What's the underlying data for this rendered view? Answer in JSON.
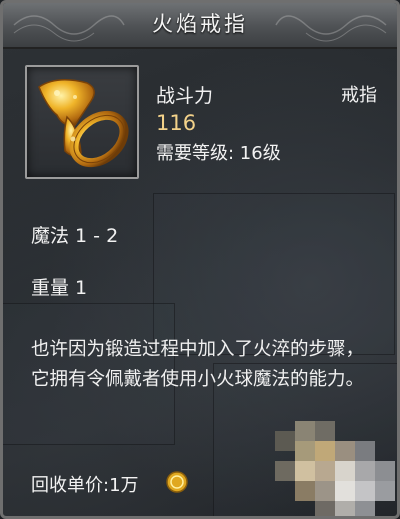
{
  "item": {
    "name": "火焰戒指",
    "power_label": "战斗力",
    "power_value": "116",
    "type": "戒指",
    "required_level": "需要等级: 16级",
    "magic": "魔法 1 - 2",
    "weight": "重量 1",
    "description": "也许因为锻造过程中加入了火淬的步骤，它拥有令佩戴者使用小火球魔法的能力。",
    "price": "回收单价:1万"
  },
  "icons": {
    "item": "fire-ring-icon",
    "currency": "gold-coin-icon"
  },
  "colors": {
    "text": "#f2f2f2",
    "power": "#f3d28a",
    "gold": "#e0a820",
    "frame": "#9b9b9b"
  }
}
